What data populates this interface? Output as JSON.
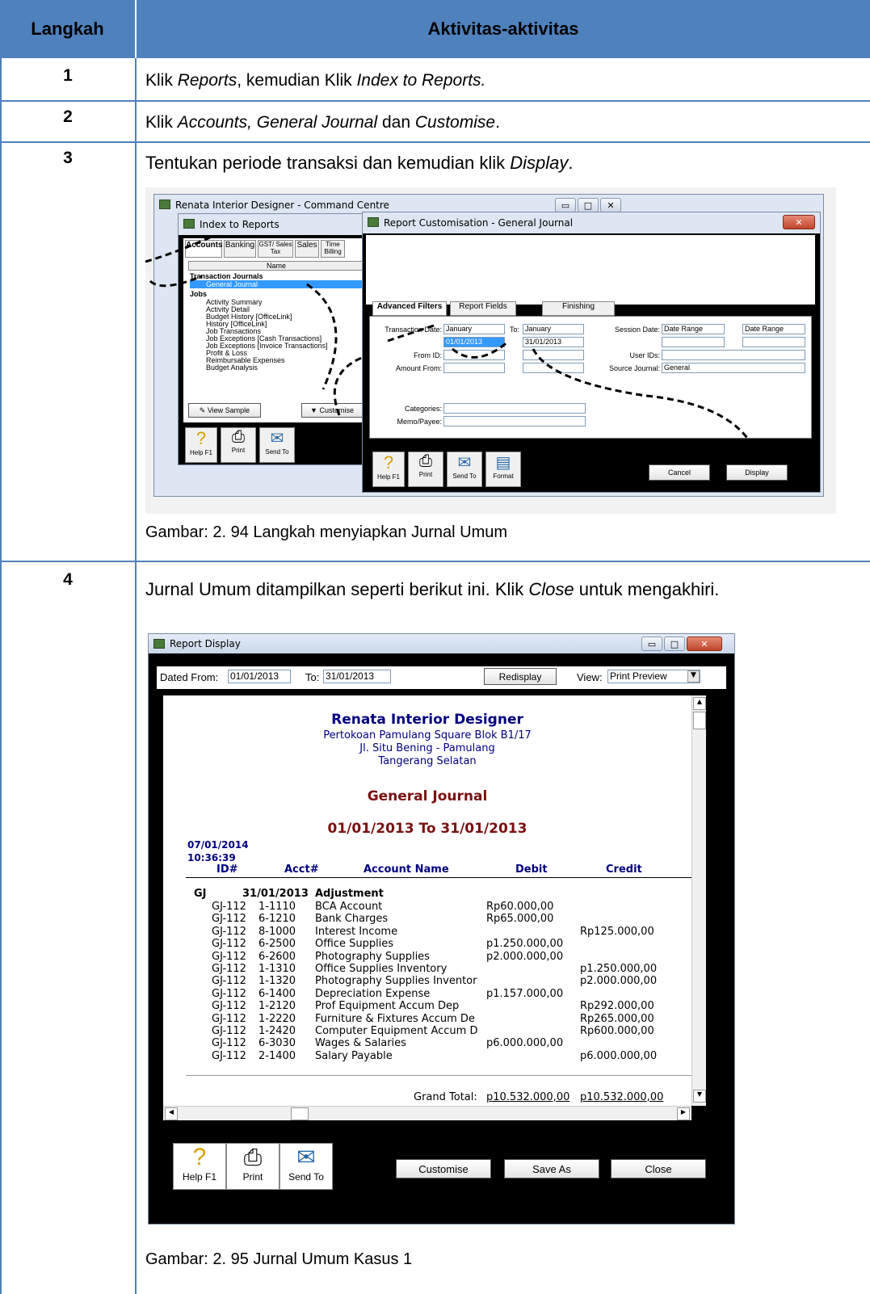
{
  "table": {
    "headers": [
      "Langkah",
      "Aktivitas-aktivitas"
    ],
    "rows": [
      {
        "step": "1",
        "text_parts": [
          "Klik ",
          "Reports",
          ", kemudian Klik ",
          "Index to Reports."
        ]
      },
      {
        "step": "2",
        "text_parts": [
          "Klik ",
          "Accounts, General Journal",
          " dan ",
          "Customise",
          "."
        ]
      },
      {
        "step": "3",
        "text_parts": [
          "Tentukan periode transaksi dan kemudian klik ",
          "Display",
          "."
        ],
        "caption": "Gambar: 2. 94 Langkah menyiapkan Jurnal Umum"
      },
      {
        "step": "4",
        "text_parts": [
          "Jurnal Umum ditampilkan seperti berikut ini. Klik ",
          "Close",
          " untuk mengakhiri."
        ],
        "caption": "Gambar: 2. 95 Jurnal Umum Kasus 1"
      }
    ]
  },
  "fig1": {
    "command_centre_title": "Renata Interior Designer - Command Centre",
    "index_title": "Index to Reports",
    "tabs": [
      "Accounts",
      "Banking",
      "GST/ Sales Tax",
      "Sales",
      "Time Billing"
    ],
    "list_header": "Name",
    "list_items": [
      "Transaction Journals",
      "General Journal",
      "Jobs",
      "Activity Summary",
      "Activity Detail",
      "Budget History [OfficeLink]",
      "History [OfficeLink]",
      "Job Transactions",
      "Job Exceptions [Cash Transactions]",
      "Job Exceptions [Invoice Transactions]",
      "Profit & Loss",
      "Reimbursable Expenses",
      "Budget Analysis"
    ],
    "view_sample": "View Sample",
    "customise": "Customise",
    "toolbar": [
      "Help F1",
      "Print",
      "Send To"
    ],
    "cust_title": "Report Customisation - General Journal",
    "cust_tabs": [
      "Advanced Filters",
      "Report Fields",
      "Finishing"
    ],
    "labels": {
      "transaction_date": "Transaction Date:",
      "to": "To:",
      "from_id": "From ID:",
      "amount_from": "Amount From:",
      "categories": "Categories:",
      "memo": "Memo/Payee:",
      "session_date": "Session Date:",
      "user_ids": "User IDs:",
      "source_journal": "Source Journal:"
    },
    "values": {
      "from_month": "January",
      "to_month": "January",
      "from_date": "01/01/2013",
      "to_date": "31/01/2013",
      "session": "Date Range",
      "session_to": "Date Range",
      "source": "General"
    },
    "cust_toolbar": [
      "Help F1",
      "Print",
      "Send To",
      "Format"
    ],
    "cancel": "Cancel",
    "display": "Display"
  },
  "fig2": {
    "title": "Report Display",
    "dated_from_label": "Dated From:",
    "dated_from": "01/01/2013",
    "to_label": "To:",
    "to": "31/01/2013",
    "redisplay": "Redisplay",
    "view_label": "View:",
    "view": "Print Preview",
    "company": "Renata Interior Designer",
    "addr1": "Pertokoan Pamulang Square Blok B1/17",
    "addr2": "Jl. Situ Bening - Pamulang",
    "addr3": "Tangerang Selatan",
    "report_title": "General Journal",
    "period": "01/01/2013 To 31/01/2013",
    "print_date": "07/01/2014",
    "print_time": "10:36:39",
    "col_headers": [
      "ID#",
      "Acct#",
      "Account Name",
      "Debit",
      "Credit"
    ],
    "journal_code": "GJ",
    "journal_date": "31/01/2013",
    "journal_memo": "Adjustment",
    "entries": [
      {
        "id": "GJ-112",
        "acct": "1-1110",
        "name": "BCA Account",
        "debit": "Rp60.000,00",
        "credit": ""
      },
      {
        "id": "GJ-112",
        "acct": "6-1210",
        "name": "Bank Charges",
        "debit": "Rp65.000,00",
        "credit": ""
      },
      {
        "id": "GJ-112",
        "acct": "8-1000",
        "name": "Interest Income",
        "debit": "",
        "credit": "Rp125.000,00"
      },
      {
        "id": "GJ-112",
        "acct": "6-2500",
        "name": "Office Supplies",
        "debit": "p1.250.000,00",
        "credit": ""
      },
      {
        "id": "GJ-112",
        "acct": "6-2600",
        "name": "Photography Supplies",
        "debit": "p2.000.000,00",
        "credit": ""
      },
      {
        "id": "GJ-112",
        "acct": "1-1310",
        "name": "Office Supplies Inventory",
        "debit": "",
        "credit": "p1.250.000,00"
      },
      {
        "id": "GJ-112",
        "acct": "1-1320",
        "name": "Photography Supplies Inventor",
        "debit": "",
        "credit": "p2.000.000,00"
      },
      {
        "id": "GJ-112",
        "acct": "6-1400",
        "name": "Depreciation Expense",
        "debit": "p1.157.000,00",
        "credit": ""
      },
      {
        "id": "GJ-112",
        "acct": "1-2120",
        "name": "Prof Equipment Accum Dep",
        "debit": "",
        "credit": "Rp292.000,00"
      },
      {
        "id": "GJ-112",
        "acct": "1-2220",
        "name": "Furniture & Fixtures Accum De",
        "debit": "",
        "credit": "Rp265.000,00"
      },
      {
        "id": "GJ-112",
        "acct": "1-2420",
        "name": "Computer Equipment Accum D",
        "debit": "",
        "credit": "Rp600.000,00"
      },
      {
        "id": "GJ-112",
        "acct": "6-3030",
        "name": "Wages & Salaries",
        "debit": "p6.000.000,00",
        "credit": ""
      },
      {
        "id": "GJ-112",
        "acct": "2-1400",
        "name": "Salary Payable",
        "debit": "",
        "credit": "p6.000.000,00"
      }
    ],
    "grand_total_label": "Grand Total:",
    "grand_total_debit": "p10.532.000,00",
    "grand_total_credit": "p10.532.000,00",
    "toolbar": [
      "Help F1",
      "Print",
      "Send To"
    ],
    "customise": "Customise",
    "save_as": "Save As",
    "close": "Close"
  }
}
